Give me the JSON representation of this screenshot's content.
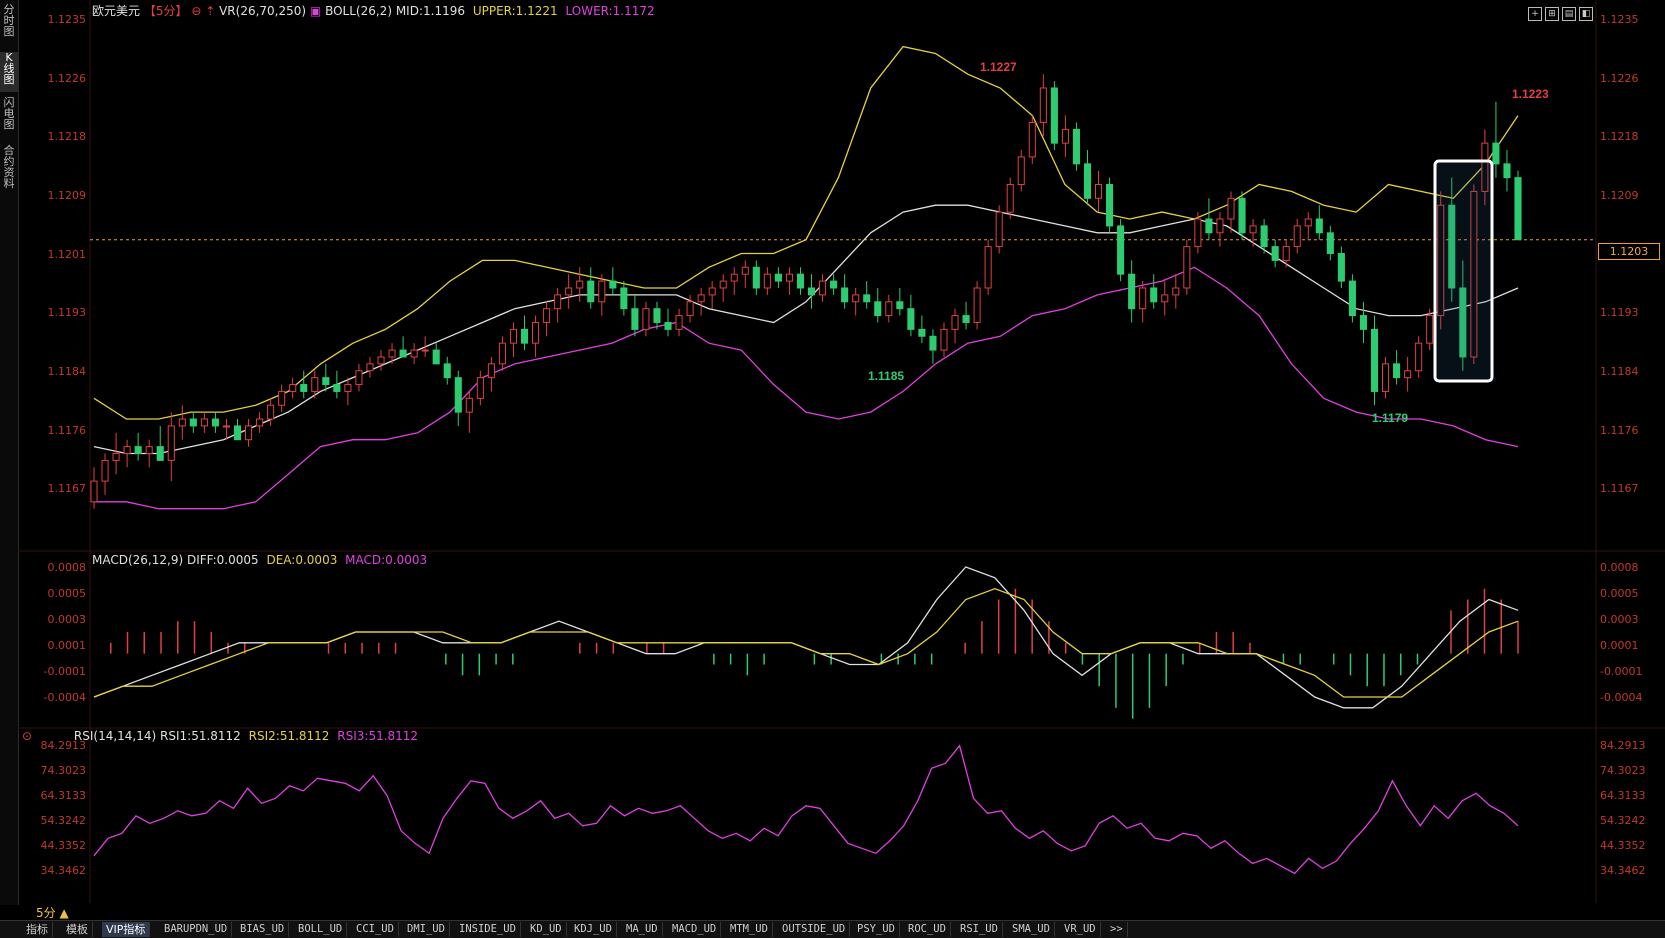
{
  "left_tabs": [
    "分时图",
    "K线图",
    "闪电图",
    "合约资料"
  ],
  "header": {
    "symbol": "欧元美元",
    "period": "【5分】",
    "vr": "VR(26,70,250)",
    "boll": "BOLL(26,2)",
    "mid": "MID:1.1196",
    "upper": "UPPER:1.1221",
    "lower": "LOWER:1.1172"
  },
  "macd_header": {
    "name": "MACD(26,12,9)",
    "diff": "DIFF:0.0005",
    "dea": "DEA:0.0003",
    "macd": "MACD:0.0003"
  },
  "rsi_header": {
    "name": "RSI(14,14,14)",
    "rsi1": "RSI1:51.8112",
    "rsi2": "RSI2:51.8112",
    "rsi3": "RSI3:51.8112"
  },
  "price_axis": [
    "1.1235",
    "1.1226",
    "1.1218",
    "1.1209",
    "1.1201",
    "1.1193",
    "1.1184",
    "1.1176",
    "1.1167"
  ],
  "current_price": "1.1203",
  "macd_axis": [
    "0.0008",
    "0.0005",
    "0.0003",
    "0.0001",
    "-0.0001",
    "-0.0004"
  ],
  "rsi_axis": [
    "84.2913",
    "74.3023",
    "64.3133",
    "54.3242",
    "44.3352",
    "34.3462"
  ],
  "annotations": {
    "high1": "1.1227",
    "low1": "1.1185",
    "low2": "1.1179",
    "high2": "1.1223"
  },
  "period_selector": "5分 ▲",
  "bottom_tabs": [
    "指标",
    "模板",
    "VIP指标",
    "BARUPDN_UD",
    "BIAS_UD",
    "BOLL_UD",
    "CCI_UD",
    "DMI_UD",
    "INSIDE_UD",
    "KD_UD",
    "KDJ_UD",
    "MA_UD",
    "MACD_UD",
    "MTM_UD",
    "OUTSIDE_UD",
    "PSY_UD",
    "ROC_UD",
    "RSI_UD",
    "SMA_UD",
    "VR_UD",
    ">>"
  ],
  "colors": {
    "up": "#e04040",
    "down": "#2ecc71",
    "upper": "#e6d23a",
    "lower": "#e040e0",
    "mid": "#e0e0e0",
    "axis_label": "#c0392b",
    "current_line": "#f0a020"
  },
  "chart_data": {
    "type": "candlestick",
    "ylim": [
      1.1162,
      1.1238
    ],
    "candles_ohlc": [
      [
        1.1165,
        1.117,
        1.1164,
        1.1168
      ],
      [
        1.1168,
        1.1172,
        1.1166,
        1.1171
      ],
      [
        1.1171,
        1.1175,
        1.1169,
        1.1172
      ],
      [
        1.1172,
        1.1174,
        1.117,
        1.1173
      ],
      [
        1.1173,
        1.1175,
        1.1171,
        1.1172
      ],
      [
        1.1172,
        1.1174,
        1.117,
        1.1173
      ],
      [
        1.1173,
        1.1176,
        1.1171,
        1.1171
      ],
      [
        1.1171,
        1.1178,
        1.1168,
        1.1176
      ],
      [
        1.1176,
        1.1179,
        1.1174,
        1.1177
      ],
      [
        1.1177,
        1.1178,
        1.1175,
        1.1176
      ],
      [
        1.1176,
        1.1178,
        1.1175,
        1.1177
      ],
      [
        1.1177,
        1.1178,
        1.1175,
        1.1176
      ],
      [
        1.1176,
        1.1177,
        1.1174,
        1.1176
      ],
      [
        1.1176,
        1.1177,
        1.1174,
        1.1174
      ],
      [
        1.1174,
        1.1177,
        1.1173,
        1.1176
      ],
      [
        1.1176,
        1.1178,
        1.1175,
        1.1177
      ],
      [
        1.1177,
        1.118,
        1.1176,
        1.1179
      ],
      [
        1.1179,
        1.1182,
        1.1178,
        1.1181
      ],
      [
        1.1181,
        1.1183,
        1.118,
        1.1182
      ],
      [
        1.1182,
        1.1184,
        1.118,
        1.1181
      ],
      [
        1.1181,
        1.1184,
        1.118,
        1.1183
      ],
      [
        1.1183,
        1.1185,
        1.1181,
        1.1182
      ],
      [
        1.1182,
        1.1184,
        1.118,
        1.1181
      ],
      [
        1.1181,
        1.1183,
        1.1179,
        1.1182
      ],
      [
        1.1182,
        1.1185,
        1.1181,
        1.1184
      ],
      [
        1.1184,
        1.1186,
        1.1183,
        1.1185
      ],
      [
        1.1185,
        1.1187,
        1.1184,
        1.1186
      ],
      [
        1.1186,
        1.1188,
        1.1185,
        1.1187
      ],
      [
        1.1187,
        1.1189,
        1.1186,
        1.1186
      ],
      [
        1.1186,
        1.1188,
        1.1185,
        1.1187
      ],
      [
        1.1187,
        1.1189,
        1.1186,
        1.1187
      ],
      [
        1.1187,
        1.1188,
        1.1185,
        1.1185
      ],
      [
        1.1185,
        1.1186,
        1.1182,
        1.1183
      ],
      [
        1.1183,
        1.1184,
        1.1176,
        1.1178
      ],
      [
        1.1178,
        1.1181,
        1.1175,
        1.118
      ],
      [
        1.118,
        1.1184,
        1.1179,
        1.1183
      ],
      [
        1.1183,
        1.1186,
        1.1181,
        1.1185
      ],
      [
        1.1185,
        1.1189,
        1.1184,
        1.1188
      ],
      [
        1.1188,
        1.1191,
        1.1186,
        1.119
      ],
      [
        1.119,
        1.1192,
        1.1187,
        1.1188
      ],
      [
        1.1188,
        1.1192,
        1.1186,
        1.1191
      ],
      [
        1.1191,
        1.1194,
        1.1189,
        1.1193
      ],
      [
        1.1193,
        1.1196,
        1.1191,
        1.1195
      ],
      [
        1.1195,
        1.1198,
        1.1193,
        1.1196
      ],
      [
        1.1196,
        1.1199,
        1.1194,
        1.1197
      ],
      [
        1.1197,
        1.1199,
        1.1193,
        1.1194
      ],
      [
        1.1194,
        1.1198,
        1.1192,
        1.1197
      ],
      [
        1.1197,
        1.1199,
        1.1195,
        1.1196
      ],
      [
        1.1196,
        1.1197,
        1.1192,
        1.1193
      ],
      [
        1.1193,
        1.1195,
        1.1189,
        1.119
      ],
      [
        1.119,
        1.1194,
        1.1189,
        1.1193
      ],
      [
        1.1193,
        1.1194,
        1.119,
        1.1191
      ],
      [
        1.1191,
        1.1193,
        1.1189,
        1.119
      ],
      [
        1.119,
        1.1193,
        1.1189,
        1.1192
      ],
      [
        1.1192,
        1.1195,
        1.1191,
        1.1194
      ],
      [
        1.1194,
        1.1196,
        1.1192,
        1.1195
      ],
      [
        1.1195,
        1.1197,
        1.1193,
        1.1196
      ],
      [
        1.1196,
        1.1198,
        1.1194,
        1.1197
      ],
      [
        1.1197,
        1.1199,
        1.1195,
        1.1198
      ],
      [
        1.1198,
        1.12,
        1.1196,
        1.1199
      ],
      [
        1.1199,
        1.12,
        1.1195,
        1.1196
      ],
      [
        1.1196,
        1.1199,
        1.1195,
        1.1198
      ],
      [
        1.1198,
        1.1199,
        1.1196,
        1.1197
      ],
      [
        1.1197,
        1.1199,
        1.1195,
        1.1198
      ],
      [
        1.1198,
        1.1199,
        1.1195,
        1.1196
      ],
      [
        1.1196,
        1.1198,
        1.1193,
        1.1195
      ],
      [
        1.1195,
        1.1198,
        1.1194,
        1.1197
      ],
      [
        1.1197,
        1.1198,
        1.1195,
        1.1196
      ],
      [
        1.1196,
        1.1198,
        1.1193,
        1.1194
      ],
      [
        1.1194,
        1.1196,
        1.1192,
        1.1195
      ],
      [
        1.1195,
        1.1197,
        1.1193,
        1.1194
      ],
      [
        1.1194,
        1.1196,
        1.1191,
        1.1192
      ],
      [
        1.1192,
        1.1195,
        1.1191,
        1.1194
      ],
      [
        1.1194,
        1.1196,
        1.1192,
        1.1193
      ],
      [
        1.1193,
        1.1195,
        1.1189,
        1.119
      ],
      [
        1.119,
        1.1192,
        1.1188,
        1.1189
      ],
      [
        1.1189,
        1.119,
        1.1185,
        1.1187
      ],
      [
        1.1187,
        1.1191,
        1.1186,
        1.119
      ],
      [
        1.119,
        1.1193,
        1.1188,
        1.1192
      ],
      [
        1.1192,
        1.1194,
        1.119,
        1.1191
      ],
      [
        1.1191,
        1.1197,
        1.119,
        1.1196
      ],
      [
        1.1196,
        1.1203,
        1.1195,
        1.1202
      ],
      [
        1.1202,
        1.1208,
        1.1201,
        1.1207
      ],
      [
        1.1207,
        1.1212,
        1.1206,
        1.1211
      ],
      [
        1.1211,
        1.1216,
        1.121,
        1.1215
      ],
      [
        1.1215,
        1.1221,
        1.1214,
        1.122
      ],
      [
        1.122,
        1.1227,
        1.1218,
        1.1225
      ],
      [
        1.1225,
        1.1226,
        1.1216,
        1.1217
      ],
      [
        1.1217,
        1.1221,
        1.1215,
        1.1219
      ],
      [
        1.1219,
        1.122,
        1.1213,
        1.1214
      ],
      [
        1.1214,
        1.1216,
        1.1208,
        1.1209
      ],
      [
        1.1209,
        1.1213,
        1.1207,
        1.1211
      ],
      [
        1.1211,
        1.1212,
        1.1204,
        1.1205
      ],
      [
        1.1205,
        1.1206,
        1.1197,
        1.1198
      ],
      [
        1.1198,
        1.12,
        1.1191,
        1.1193
      ],
      [
        1.1193,
        1.1197,
        1.1191,
        1.1196
      ],
      [
        1.1196,
        1.1198,
        1.1193,
        1.1194
      ],
      [
        1.1194,
        1.1197,
        1.1192,
        1.1195
      ],
      [
        1.1195,
        1.1198,
        1.1193,
        1.1196
      ],
      [
        1.1196,
        1.1203,
        1.1195,
        1.1202
      ],
      [
        1.1202,
        1.1207,
        1.1201,
        1.1206
      ],
      [
        1.1206,
        1.1209,
        1.1203,
        1.1204
      ],
      [
        1.1204,
        1.1207,
        1.1202,
        1.1206
      ],
      [
        1.1206,
        1.121,
        1.1204,
        1.1209
      ],
      [
        1.1209,
        1.121,
        1.1203,
        1.1204
      ],
      [
        1.1204,
        1.1206,
        1.1202,
        1.1205
      ],
      [
        1.1205,
        1.1206,
        1.1201,
        1.1202
      ],
      [
        1.1202,
        1.1203,
        1.1199,
        1.12
      ],
      [
        1.12,
        1.1203,
        1.1199,
        1.1202
      ],
      [
        1.1202,
        1.1206,
        1.1201,
        1.1205
      ],
      [
        1.1205,
        1.1207,
        1.1203,
        1.1206
      ],
      [
        1.1206,
        1.1208,
        1.1203,
        1.1204
      ],
      [
        1.1204,
        1.1205,
        1.12,
        1.1201
      ],
      [
        1.1201,
        1.1202,
        1.1196,
        1.1197
      ],
      [
        1.1197,
        1.1198,
        1.1191,
        1.1192
      ],
      [
        1.1192,
        1.1194,
        1.1188,
        1.119
      ],
      [
        1.119,
        1.1192,
        1.1179,
        1.1181
      ],
      [
        1.1181,
        1.1186,
        1.118,
        1.1185
      ],
      [
        1.1185,
        1.1187,
        1.1182,
        1.1183
      ],
      [
        1.1183,
        1.1186,
        1.1181,
        1.1184
      ],
      [
        1.1184,
        1.1189,
        1.1183,
        1.1188
      ],
      [
        1.1188,
        1.1193,
        1.1187,
        1.1192
      ],
      [
        1.1192,
        1.121,
        1.119,
        1.1208
      ],
      [
        1.1208,
        1.1212,
        1.1194,
        1.1196
      ],
      [
        1.1196,
        1.12,
        1.1184,
        1.1186
      ],
      [
        1.1186,
        1.1211,
        1.1185,
        1.121
      ],
      [
        1.121,
        1.1219,
        1.1208,
        1.1217
      ],
      [
        1.1217,
        1.1223,
        1.1212,
        1.1214
      ],
      [
        1.1214,
        1.1216,
        1.121,
        1.1212
      ],
      [
        1.1212,
        1.1213,
        1.1203,
        1.1203
      ]
    ],
    "boll_upper": [
      1.118,
      1.1177,
      1.1177,
      1.1178,
      1.1178,
      1.1179,
      1.1181,
      1.1185,
      1.1188,
      1.119,
      1.1193,
      1.1197,
      1.12,
      1.12,
      1.1199,
      1.1198,
      1.1197,
      1.1196,
      1.1196,
      1.1199,
      1.1201,
      1.1201,
      1.1203,
      1.1212,
      1.1225,
      1.1231,
      1.123,
      1.1227,
      1.1225,
      1.1221,
      1.1211,
      1.1207,
      1.1206,
      1.1207,
      1.1206,
      1.1208,
      1.1211,
      1.121,
      1.1208,
      1.1207,
      1.1211,
      1.121,
      1.1209,
      1.1214,
      1.1221
    ],
    "boll_mid": [
      1.1173,
      1.1172,
      1.1172,
      1.1173,
      1.1174,
      1.1176,
      1.1178,
      1.1181,
      1.1183,
      1.1185,
      1.1187,
      1.1189,
      1.1191,
      1.1193,
      1.1194,
      1.1195,
      1.1195,
      1.1195,
      1.1195,
      1.1193,
      1.1192,
      1.1191,
      1.1194,
      1.1199,
      1.1204,
      1.1207,
      1.1208,
      1.1208,
      1.1207,
      1.1206,
      1.1205,
      1.1204,
      1.1204,
      1.1205,
      1.1206,
      1.1205,
      1.1202,
      1.1199,
      1.1196,
      1.1193,
      1.1192,
      1.1192,
      1.1193,
      1.1194,
      1.1196
    ],
    "boll_lower": [
      1.1165,
      1.1165,
      1.1164,
      1.1164,
      1.1164,
      1.1165,
      1.1169,
      1.1173,
      1.1174,
      1.1174,
      1.1175,
      1.1178,
      1.1183,
      1.1185,
      1.1186,
      1.1187,
      1.1188,
      1.119,
      1.1191,
      1.1188,
      1.1187,
      1.1182,
      1.1178,
      1.1177,
      1.1178,
      1.1181,
      1.1185,
      1.1188,
      1.1189,
      1.1192,
      1.1193,
      1.1195,
      1.1196,
      1.1197,
      1.1199,
      1.1196,
      1.1192,
      1.1185,
      1.118,
      1.1178,
      1.1177,
      1.1177,
      1.1176,
      1.1174,
      1.1173
    ],
    "macd_hist": [
      0.0,
      0.0001,
      0.0002,
      0.0002,
      0.0002,
      0.0003,
      0.0003,
      0.0002,
      0.0001,
      0.0001,
      0.0,
      0.0,
      0.0,
      0.0,
      0.0001,
      0.0001,
      0.0001,
      0.0001,
      0.0001,
      0.0,
      0.0,
      -0.0001,
      -0.0002,
      -0.0002,
      -0.0001,
      -0.0001,
      0.0,
      0.0,
      0.0,
      0.0001,
      0.0001,
      0.0001,
      0.0,
      0.0001,
      0.0001,
      0.0,
      0.0,
      -0.0001,
      -0.0001,
      -0.0002,
      -0.0001,
      0.0,
      0.0,
      -0.0001,
      -0.0001,
      0.0,
      0.0,
      -0.0001,
      -0.0001,
      -0.0001,
      -0.0001,
      0.0,
      0.0001,
      0.0003,
      0.0005,
      0.0006,
      0.0005,
      0.0003,
      0.0001,
      -0.0001,
      -0.0003,
      -0.0005,
      -0.0006,
      -0.0005,
      -0.0003,
      -0.0001,
      0.0001,
      0.0002,
      0.0002,
      0.0001,
      0.0,
      -0.0001,
      -0.0001,
      0.0,
      -0.0001,
      -0.0002,
      -0.0003,
      -0.0003,
      -0.0002,
      -0.0001,
      0.0,
      0.0004,
      0.0005,
      0.0006,
      0.0005,
      0.0003
    ],
    "macd_diff": [
      -0.0004,
      -0.0003,
      -0.0002,
      -0.0001,
      0.0,
      0.0001,
      0.0001,
      0.0001,
      0.0001,
      0.0002,
      0.0002,
      0.0002,
      0.0001,
      0.0001,
      0.0001,
      0.0002,
      0.0003,
      0.0002,
      0.0001,
      0.0,
      0.0,
      0.0001,
      0.0001,
      0.0001,
      0.0001,
      0.0,
      -0.0001,
      -0.0001,
      0.0001,
      0.0005,
      0.0008,
      0.0007,
      0.0004,
      0.0,
      -0.0002,
      0.0,
      0.0001,
      0.0001,
      0.0,
      0.0,
      0.0,
      -0.0002,
      -0.0004,
      -0.0005,
      -0.0005,
      -0.0003,
      0.0,
      0.0003,
      0.0005,
      0.0004
    ],
    "macd_dea": [
      -0.0004,
      -0.0003,
      -0.0003,
      -0.0002,
      -0.0001,
      0.0,
      0.0001,
      0.0001,
      0.0001,
      0.0002,
      0.0002,
      0.0002,
      0.0002,
      0.0001,
      0.0001,
      0.0002,
      0.0002,
      0.0002,
      0.0001,
      0.0001,
      0.0001,
      0.0001,
      0.0001,
      0.0001,
      0.0001,
      0.0,
      0.0,
      -0.0001,
      0.0,
      0.0002,
      0.0005,
      0.0006,
      0.0005,
      0.0002,
      0.0,
      0.0,
      0.0001,
      0.0001,
      0.0001,
      0.0,
      0.0,
      -0.0001,
      -0.0002,
      -0.0004,
      -0.0004,
      -0.0004,
      -0.0002,
      0.0,
      0.0002,
      0.0003
    ],
    "rsi1": [
      40,
      47,
      49,
      56,
      53,
      55,
      58,
      56,
      57,
      62,
      59,
      67,
      61,
      63,
      68,
      66,
      71,
      70,
      69,
      66,
      72,
      64,
      50,
      45,
      41,
      55,
      63,
      70,
      69,
      59,
      55,
      58,
      62,
      55,
      57,
      52,
      53,
      60,
      56,
      59,
      57,
      58,
      60,
      55,
      50,
      47,
      49,
      46,
      51,
      48,
      56,
      60,
      59,
      52,
      45,
      43,
      41,
      46,
      52,
      62,
      75,
      77,
      84,
      63,
      57,
      58,
      51,
      47,
      50,
      45,
      42,
      44,
      53,
      56,
      51,
      53,
      47,
      46,
      49,
      48,
      43,
      46,
      41,
      37,
      39,
      36,
      33,
      39,
      35,
      38,
      45,
      51,
      58,
      70,
      60,
      52,
      60,
      55,
      62,
      65,
      60,
      57,
      52
    ]
  }
}
